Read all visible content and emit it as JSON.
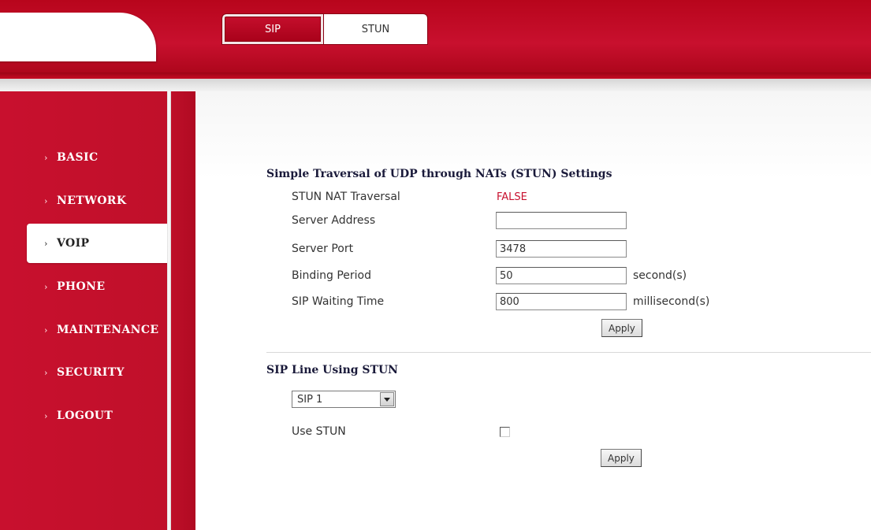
{
  "header": {
    "tabs": [
      {
        "label": "SIP",
        "active": true
      },
      {
        "label": "STUN",
        "active": false
      }
    ]
  },
  "sidebar": {
    "items": [
      {
        "label": "BASIC",
        "active": false
      },
      {
        "label": "NETWORK",
        "active": false
      },
      {
        "label": "VOIP",
        "active": true
      },
      {
        "label": "PHONE",
        "active": false
      },
      {
        "label": "MAINTENANCE",
        "active": false
      },
      {
        "label": "SECURITY",
        "active": false
      },
      {
        "label": "LOGOUT",
        "active": false
      }
    ]
  },
  "stun_settings": {
    "title": "Simple Traversal of UDP through NATs (STUN) Settings",
    "nat_traversal_label": "STUN NAT Traversal",
    "nat_traversal_value": "FALSE",
    "server_address_label": "Server Address",
    "server_address_value": "",
    "server_port_label": "Server Port",
    "server_port_value": "3478",
    "binding_period_label": "Binding Period",
    "binding_period_value": "50",
    "binding_period_unit": "second(s)",
    "sip_waiting_time_label": "SIP Waiting Time",
    "sip_waiting_time_value": "800",
    "sip_waiting_time_unit": "millisecond(s)",
    "apply_label": "Apply"
  },
  "sip_line": {
    "title": "SIP Line Using STUN",
    "selected_line": "SIP 1",
    "use_stun_label": "Use STUN",
    "use_stun_checked": false,
    "apply_label": "Apply"
  },
  "colors": {
    "brand_red": "#c8102e",
    "status_red": "#c8102e"
  },
  "icons": {
    "menu_bullet": "chevron-right-icon",
    "select_arrow": "triangle-down-icon"
  }
}
